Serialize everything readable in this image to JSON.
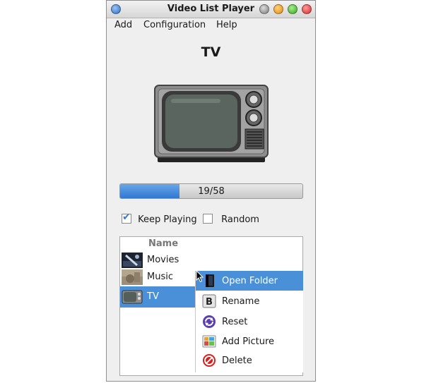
{
  "window": {
    "title": "Video List Player"
  },
  "menubar": {
    "items": [
      "Add",
      "Configuration",
      "Help"
    ]
  },
  "main": {
    "heading": "TV",
    "progress": {
      "text": "19/58",
      "value": 19,
      "max": 58,
      "fill_fraction": 0.327
    },
    "options": [
      {
        "label": "Keep Playing",
        "checked": true
      },
      {
        "label": "Random",
        "checked": false
      }
    ]
  },
  "list": {
    "header": "Name",
    "rows": [
      {
        "label": "Movies",
        "selected": false
      },
      {
        "label": "Music",
        "selected": false
      },
      {
        "label": "TV",
        "selected": true
      }
    ]
  },
  "context_menu": {
    "items": [
      {
        "label": "Open Folder",
        "icon": "folder-icon",
        "highlighted": true
      },
      {
        "label": "Rename",
        "icon": "rename-icon",
        "highlighted": false
      },
      {
        "label": "Reset",
        "icon": "reset-icon",
        "highlighted": false
      },
      {
        "label": "Add Picture",
        "icon": "add-picture-icon",
        "highlighted": false
      },
      {
        "label": "Delete",
        "icon": "delete-icon",
        "highlighted": false
      }
    ]
  },
  "colors": {
    "accent": "#4a90d9",
    "titlebar": "#e3e3e3",
    "window_bg": "#efefef"
  }
}
